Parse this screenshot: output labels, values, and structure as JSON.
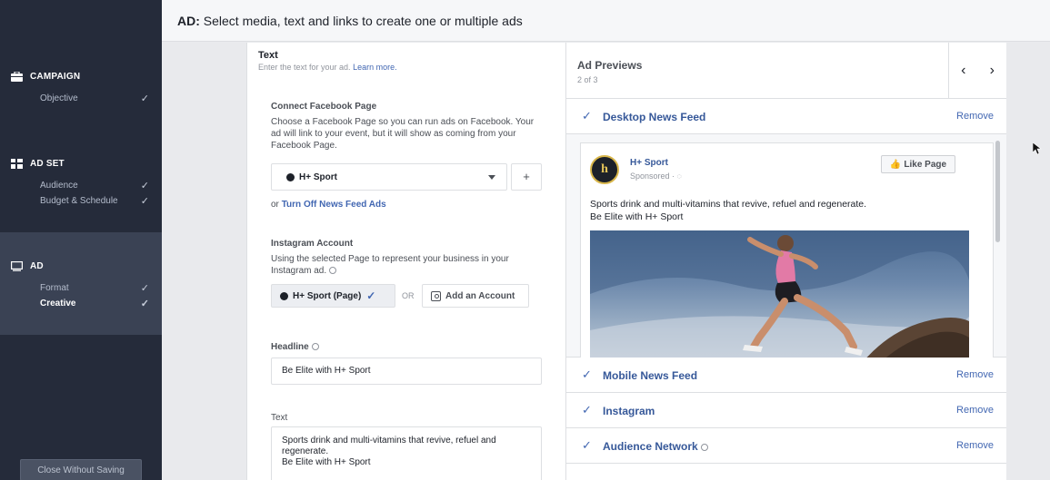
{
  "sidebar": {
    "campaign": {
      "title": "CAMPAIGN",
      "items": [
        {
          "label": "Objective"
        }
      ]
    },
    "adset": {
      "title": "AD SET",
      "items": [
        {
          "label": "Audience"
        },
        {
          "label": "Budget & Schedule"
        }
      ]
    },
    "ad": {
      "title": "AD",
      "items": [
        {
          "label": "Format"
        },
        {
          "label": "Creative"
        }
      ]
    },
    "close_label": "Close Without Saving"
  },
  "header": {
    "prefix": "AD:",
    "text": "Select media, text and links to create one or multiple ads"
  },
  "form": {
    "title": "Text",
    "subtitle": "Enter the text for your ad.",
    "learn_more": "Learn more.",
    "fb_page": {
      "label": "Connect Facebook Page",
      "description": "Choose a Facebook Page so you can run ads on Facebook. Your ad will link to your event, but it will show as coming from your Facebook Page.",
      "selected": "H+ Sport",
      "add_symbol": "+",
      "turnoff_prefix": "or",
      "turnoff_link": "Turn Off News Feed Ads"
    },
    "instagram": {
      "label": "Instagram Account",
      "description": "Using the selected Page to represent your business in your Instagram ad.",
      "selected": "H+ Sport (Page)",
      "or": "OR",
      "add_account": "Add an Account"
    },
    "headline": {
      "label": "Headline",
      "value": "Be Elite with H+ Sport"
    },
    "text": {
      "label": "Text",
      "value": "Sports drink and multi-vitamins that revive, refuel and regenerate.\nBe Elite with H+ Sport"
    }
  },
  "preview": {
    "title": "Ad Previews",
    "count": "2 of 3",
    "placements": [
      {
        "name": "Desktop News Feed",
        "remove": "Remove"
      },
      {
        "name": "Mobile News Feed",
        "remove": "Remove"
      },
      {
        "name": "Instagram",
        "remove": "Remove"
      },
      {
        "name": "Audience Network",
        "remove": "Remove"
      }
    ],
    "card": {
      "logo_letter": "h",
      "page_name": "H+ Sport",
      "sponsored": "Sponsored · ",
      "like_button": "Like Page",
      "body_line1": "Sports drink and multi-vitamins that revive, refuel and regenerate.",
      "body_line2": "Be Elite with H+ Sport"
    }
  },
  "colors": {
    "sidebar_bg": "#252b3a",
    "accent": "#4267b2",
    "link": "#365899"
  }
}
